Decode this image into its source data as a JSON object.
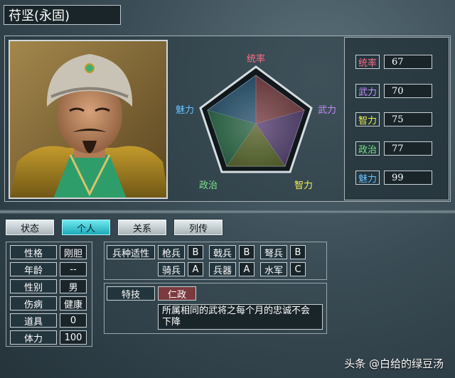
{
  "general": {
    "name": "苻坚(永固)"
  },
  "radar": {
    "labels": {
      "top": "统率",
      "right": "武力",
      "bottom_right": "智力",
      "bottom_left": "政治",
      "left": "魅力"
    }
  },
  "stats": [
    {
      "label": "统率",
      "value": "67",
      "color": "#ff6f86"
    },
    {
      "label": "武力",
      "value": "70",
      "color": "#c78cff"
    },
    {
      "label": "智力",
      "value": "75",
      "color": "#f2ee55"
    },
    {
      "label": "政治",
      "value": "77",
      "color": "#7de38a"
    },
    {
      "label": "魅力",
      "value": "99",
      "color": "#66c2ff"
    }
  ],
  "tabs": [
    "状态",
    "个人",
    "关系",
    "列传"
  ],
  "active_tab": "个人",
  "personal": [
    {
      "label": "性格",
      "value": "刚胆"
    },
    {
      "label": "年龄",
      "value": "--"
    },
    {
      "label": "性别",
      "value": "男"
    },
    {
      "label": "伤病",
      "value": "健康"
    },
    {
      "label": "道具",
      "value": "0"
    },
    {
      "label": "体力",
      "value": "100"
    }
  ],
  "aptitude": {
    "header": "兵种适性",
    "row1": [
      {
        "label": "枪兵",
        "grade": "B"
      },
      {
        "label": "戟兵",
        "grade": "B"
      },
      {
        "label": "弩兵",
        "grade": "B"
      }
    ],
    "row2": [
      {
        "label": "骑兵",
        "grade": "A"
      },
      {
        "label": "兵器",
        "grade": "A"
      },
      {
        "label": "水军",
        "grade": "C"
      }
    ]
  },
  "skill": {
    "header": "特技",
    "name": "仁政",
    "description": "所属相同的武将之每个月的忠诚不会下降"
  },
  "watermark": "头条 @白给的绿豆汤",
  "colors": {
    "accent_cyan": "#2fc3cf",
    "skill_red": "#7a3a3e"
  }
}
